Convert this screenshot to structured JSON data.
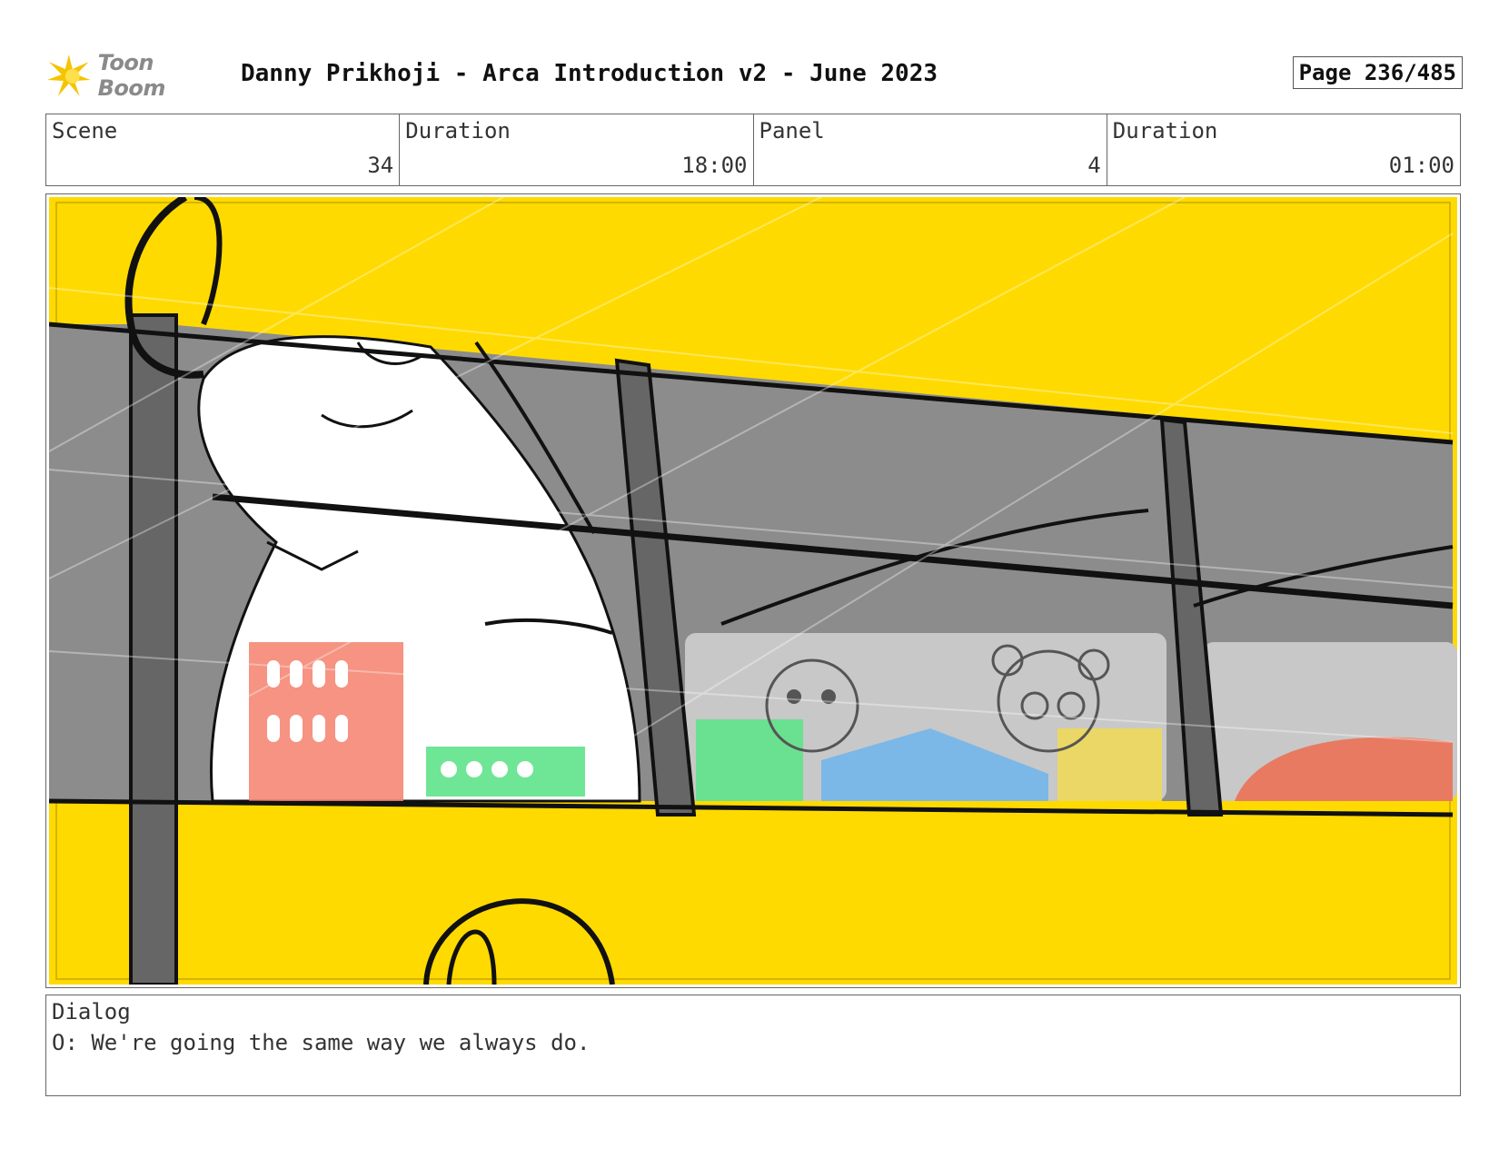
{
  "header": {
    "logo_text": "Toon Boom",
    "title": "Danny Prikhoji - Arca Introduction v2 - June 2023",
    "page": "Page 236/485"
  },
  "info": {
    "scene_label": "Scene",
    "scene_value": "34",
    "scene_duration_label": "Duration",
    "scene_duration_value": "18:00",
    "panel_label": "Panel",
    "panel_value": "4",
    "panel_duration_label": "Duration",
    "panel_duration_value": "01:00"
  },
  "colors": {
    "bus_yellow": "#FFDA00",
    "window_gray": "#8c8c8c",
    "sketch_line": "#111111",
    "building_red": "#F4806C",
    "building_green": "#5FE38A",
    "building_blue": "#7BB8E8",
    "building_yellow": "#EDD85A"
  },
  "dialog": {
    "label": "Dialog",
    "text": "O: We're going the same way we always do."
  }
}
